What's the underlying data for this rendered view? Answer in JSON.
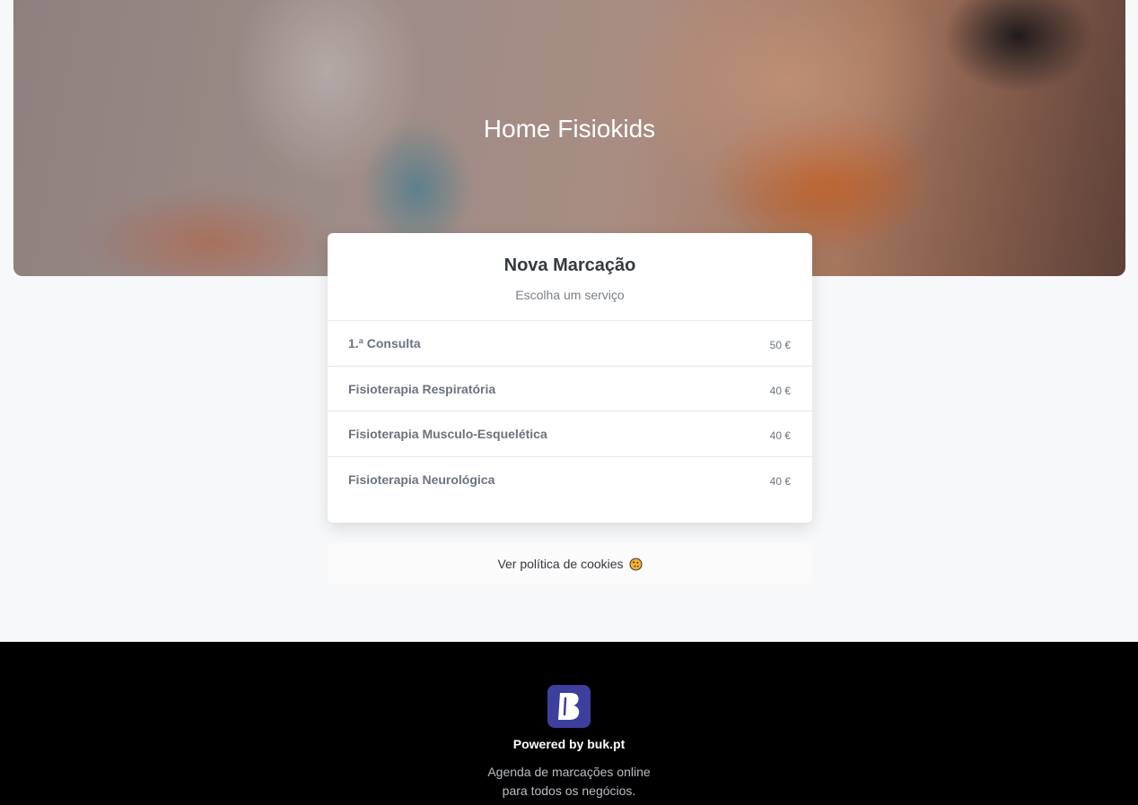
{
  "hero": {
    "title": "Home Fisiokids"
  },
  "booking": {
    "title": "Nova Marcação",
    "subtitle": "Escolha um serviço",
    "services": [
      {
        "name": "1.ª Consulta",
        "price": "50 €"
      },
      {
        "name": "Fisioterapia Respiratória",
        "price": "40 €"
      },
      {
        "name": "Fisioterapia Musculo-Esquelética",
        "price": "40 €"
      },
      {
        "name": "Fisioterapia Neurológica",
        "price": "40 €"
      }
    ]
  },
  "cookies": {
    "label": "Ver política de cookies",
    "icon": "cookie-icon"
  },
  "footer": {
    "logo_icon": "buk-logo-icon",
    "brand_color": "#3d3f9e",
    "powered_by": "Powered by buk.pt",
    "tagline_line1": "Agenda de marcações online",
    "tagline_line2": "para todos os negócios."
  }
}
